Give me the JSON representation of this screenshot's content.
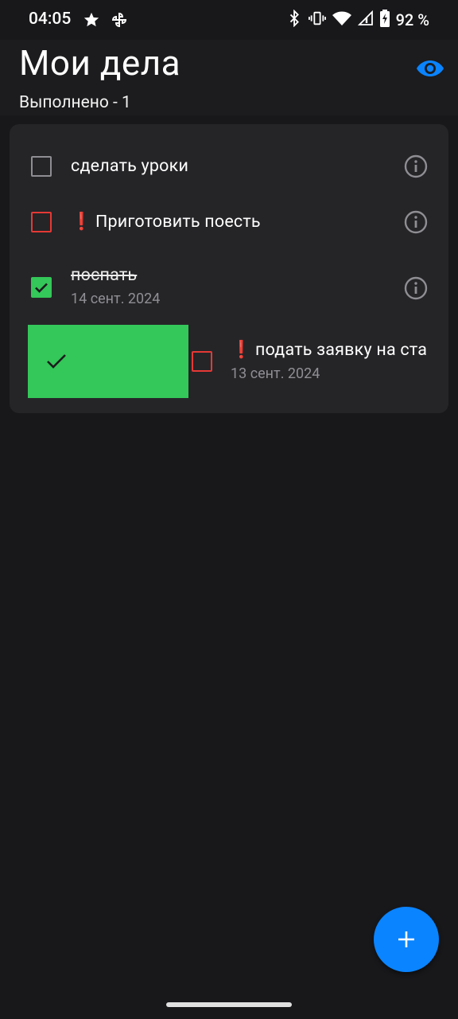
{
  "status_bar": {
    "time": "04:05",
    "battery_percent": "92 %",
    "icons": [
      "star-icon",
      "pinwheel-icon",
      "bluetooth-icon",
      "vibrate-icon",
      "wifi-icon",
      "signal-icon",
      "battery-charging-icon"
    ]
  },
  "header": {
    "title": "Мои дела",
    "done_label": "Выполнено - 1",
    "visibility_icon": "eye-icon"
  },
  "tasks": [
    {
      "text": "сделать уроки",
      "important": false,
      "done": false,
      "date": ""
    },
    {
      "text": "Приготовить поесть",
      "important": true,
      "done": false,
      "date": ""
    },
    {
      "text": "поспать",
      "important": false,
      "done": true,
      "date": "14 сент. 2024"
    },
    {
      "text": "подать заявку на ста",
      "important": true,
      "done": false,
      "date": "13 сент. 2024",
      "swiping": true
    }
  ],
  "important_mark": "❗",
  "fab": {
    "icon": "plus-icon"
  },
  "colors": {
    "background": "#18181b",
    "card": "#252528",
    "accent": "#0a84ff",
    "done_green": "#34c759",
    "important_red": "#e53935"
  }
}
